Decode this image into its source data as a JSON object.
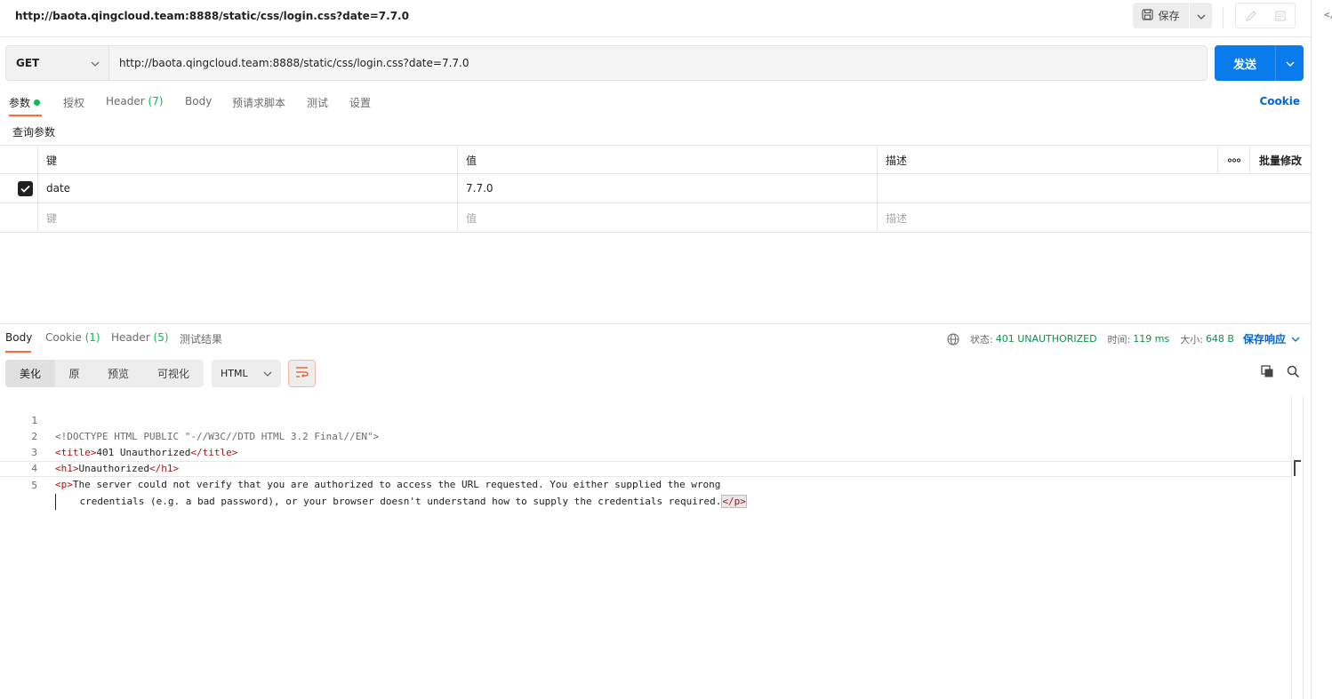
{
  "request": {
    "title": "http://baota.qingcloud.team:8888/static/css/login.css?date=7.7.0",
    "save_label": "保存",
    "method": "GET",
    "url": "http://baota.qingcloud.team:8888/static/css/login.css?date=7.7.0",
    "send_label": "发送"
  },
  "request_tabs": {
    "params": "参数",
    "auth": "授权",
    "header": "Header",
    "header_count": "(7)",
    "body": "Body",
    "prerequest": "预请求脚本",
    "tests": "测试",
    "settings": "设置",
    "cookie": "Cookie"
  },
  "params": {
    "section_label": "查询参数",
    "headers": {
      "key": "键",
      "value": "值",
      "description": "描述",
      "more": "ooo",
      "bulk": "批量修改"
    },
    "rows": [
      {
        "checked": true,
        "key": "date",
        "value": "7.7.0",
        "description": ""
      }
    ],
    "placeholders": {
      "key": "键",
      "value": "值",
      "description": "描述"
    }
  },
  "response_tabs": {
    "body": "Body",
    "cookie": "Cookie",
    "cookie_count": "(1)",
    "header": "Header",
    "header_count": "(5)",
    "tests": "测试结果"
  },
  "response_status": {
    "status_label": "状态:",
    "status_value": "401 UNAUTHORIZED",
    "time_label": "时间:",
    "time_value": "119 ms",
    "size_label": "大小:",
    "size_value": "648 B",
    "save_label": "保存响应"
  },
  "view_modes": {
    "pretty": "美化",
    "raw": "原",
    "preview": "预览",
    "visualize": "可视化",
    "language": "HTML"
  },
  "code": {
    "line_numbers": [
      "1",
      "2",
      "3",
      "4",
      "5"
    ],
    "l1": "<!DOCTYPE HTML PUBLIC \"-//W3C//DTD HTML 3.2 Final//EN\">",
    "l2_open": "<title>",
    "l2_text": "401 Unauthorized",
    "l2_close": "</title>",
    "l3_open": "<h1>",
    "l3_text": "Unauthorized",
    "l3_close": "</h1>",
    "l4_open": "<p>",
    "l4_text": "The server could not verify that you are authorized to access the URL requested. You either supplied the wrong",
    "l5_text": "    credentials (e.g. a bad password), or your browser doesn't understand how to supply the credentials required.",
    "l5_close": "</p>"
  },
  "colors": {
    "accent": "#097bed",
    "tab_underline": "#ff6c37",
    "count_green": "#0cbb52",
    "tag_red": "#a31515"
  }
}
